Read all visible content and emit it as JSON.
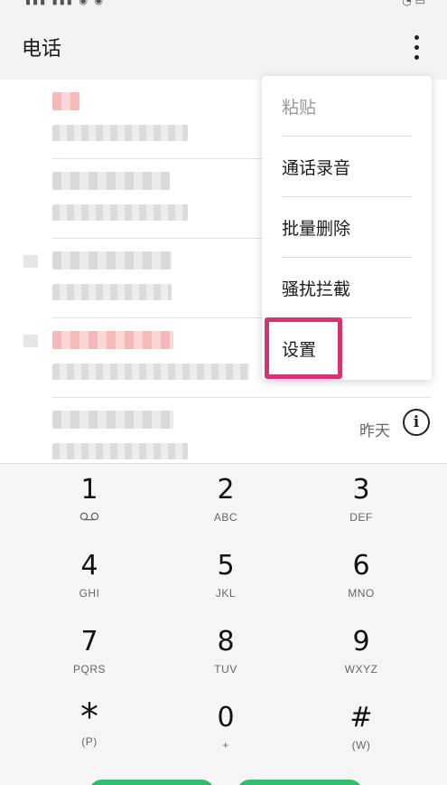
{
  "header": {
    "title": "电话"
  },
  "call_log": {
    "recent_time": "昨天"
  },
  "menu": {
    "items": [
      {
        "label": "粘贴",
        "enabled": false
      },
      {
        "label": "通话录音",
        "enabled": true
      },
      {
        "label": "批量删除",
        "enabled": true
      },
      {
        "label": "骚扰拦截",
        "enabled": true
      },
      {
        "label": "设置",
        "enabled": true,
        "highlighted": true
      }
    ]
  },
  "dialpad": {
    "keys": [
      {
        "digit": "1",
        "letters": ""
      },
      {
        "digit": "2",
        "letters": "ABC"
      },
      {
        "digit": "3",
        "letters": "DEF"
      },
      {
        "digit": "4",
        "letters": "GHI"
      },
      {
        "digit": "5",
        "letters": "JKL"
      },
      {
        "digit": "6",
        "letters": "MNO"
      },
      {
        "digit": "7",
        "letters": "PQRS"
      },
      {
        "digit": "8",
        "letters": "TUV"
      },
      {
        "digit": "9",
        "letters": "WXYZ"
      },
      {
        "digit": "*",
        "letters": "(P)"
      },
      {
        "digit": "0",
        "letters": "+"
      },
      {
        "digit": "#",
        "letters": "(W)"
      }
    ]
  },
  "colors": {
    "highlight_border": "#d63372",
    "dial_green": "#2fbf6e",
    "missed_call": "#f6b9b9"
  }
}
